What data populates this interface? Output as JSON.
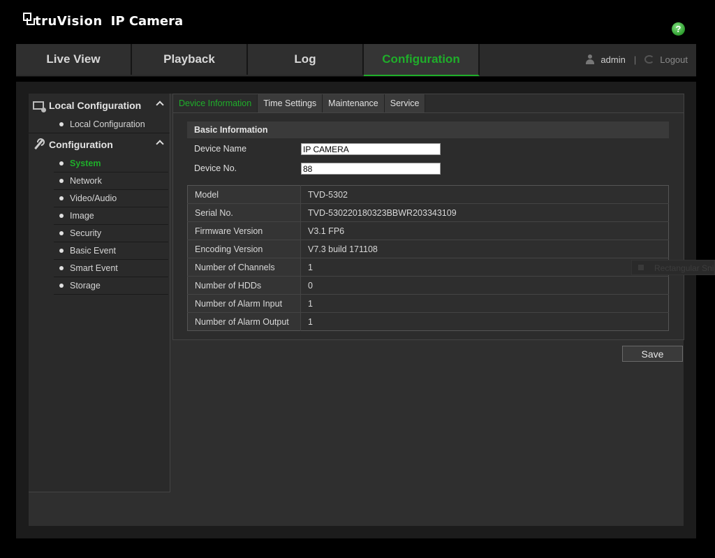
{
  "header": {
    "brand": "truVision",
    "product": "IP Camera",
    "help_icon": "help-icon",
    "help_glyph": "?"
  },
  "topnav": {
    "tabs": [
      {
        "label": "Live View"
      },
      {
        "label": "Playback"
      },
      {
        "label": "Log"
      },
      {
        "label": "Configuration",
        "active": true
      }
    ],
    "user": "admin",
    "separator": "|",
    "logout": "Logout"
  },
  "sidebar": {
    "groups": [
      {
        "label": "Local Configuration",
        "icon": "monitor-icon",
        "items": [
          "Local Configuration"
        ]
      },
      {
        "label": "Configuration",
        "icon": "wrench-icon",
        "items": [
          "System",
          "Network",
          "Video/Audio",
          "Image",
          "Security",
          "Basic Event",
          "Smart Event",
          "Storage"
        ],
        "active_item": "System"
      }
    ]
  },
  "subtabs": [
    "Device Information",
    "Time Settings",
    "Maintenance",
    "Service"
  ],
  "basic_info": {
    "title": "Basic Information",
    "device_name_label": "Device Name",
    "device_name_value": "IP CAMERA",
    "device_no_label": "Device No.",
    "device_no_value": "88"
  },
  "info_rows": [
    {
      "key": "Model",
      "value": "TVD-5302"
    },
    {
      "key": "Serial No.",
      "value": "TVD-530220180323BBWR203343109"
    },
    {
      "key": "Firmware Version",
      "value": "V3.1 FP6"
    },
    {
      "key": "Encoding Version",
      "value": "V7.3 build 171108"
    },
    {
      "key": "Number of Channels",
      "value": "1"
    },
    {
      "key": "Number of HDDs",
      "value": "0"
    },
    {
      "key": "Number of Alarm Input",
      "value": "1"
    },
    {
      "key": "Number of Alarm Output",
      "value": "1"
    }
  ],
  "save_label": "Save",
  "overlay": {
    "label": "Rectangular Snip"
  },
  "colors": {
    "accent": "#1fae2a",
    "background": "#000000",
    "panel": "#2f2f2f"
  }
}
